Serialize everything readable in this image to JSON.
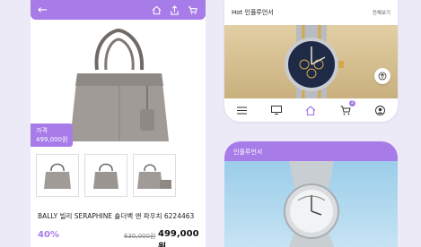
{
  "left_screen": {
    "topbar_icons": [
      "back-arrow-icon",
      "home-icon",
      "share-icon",
      "cart-icon"
    ],
    "price_tag": {
      "label": "가격",
      "value": "499,000원"
    },
    "product_title": "BALLY 빌리 SERAPHINE 숄더백 앤 파우치 6224463",
    "discount": "40%",
    "original_price": "630,000원",
    "sale_price": "499,000원",
    "thumbnail_count": 3
  },
  "right_top": {
    "section_title": "Hot 인플루언서",
    "more_label": "전체보기",
    "cart_badge": "2",
    "nav_icons": [
      "menu-icon",
      "tv-icon",
      "home-icon",
      "cart-icon",
      "profile-icon"
    ]
  },
  "right_bottom": {
    "section_title": "인플루언서"
  },
  "colors": {
    "accent": "#a77be8",
    "background": "#eceaf6",
    "gold_banner": "#d8c292",
    "sky_banner": "#a9d5ee"
  }
}
